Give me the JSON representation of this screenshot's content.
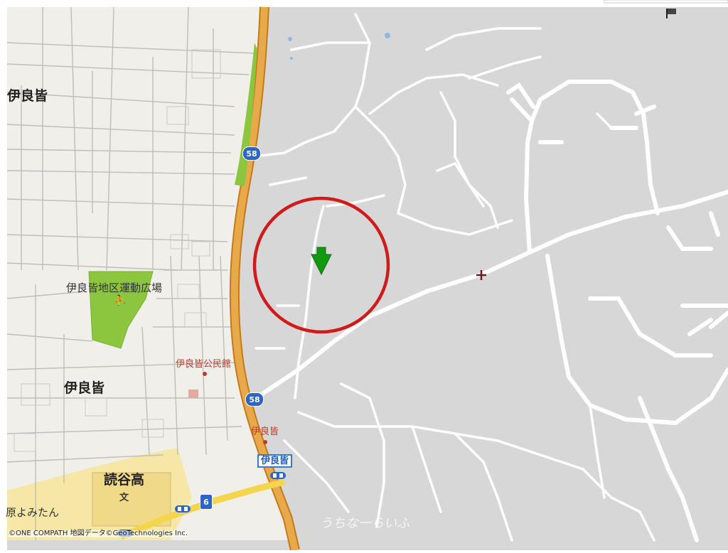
{
  "places": {
    "irabina_top": "伊良皆",
    "irabina_center": "伊良皆",
    "sports_ground": "伊良皆地区運動広場",
    "community_hall": "伊良皆公民館",
    "bus_stop": "伊良皆",
    "station_label": "伊良皆",
    "high_school": "読谷高",
    "school_symbol": "文",
    "park_symbol": "⛹",
    "yomitan": "原よみたん"
  },
  "routes": {
    "r58_top": "58",
    "r58_bottom": "58",
    "r6": "6"
  },
  "credit": "©ONE COMPATH 地図データ©GeoTechnologies Inc.",
  "watermark": "うちな一らいふ",
  "colors": {
    "base_land": "#d7d7d7",
    "town_land": "#f0efe9",
    "highway_fill": "#e8a94a",
    "highway_edge": "#c47a1a",
    "green_park": "#8cc63f",
    "school_yellow": "#f6e7a6",
    "circle_red": "#d11a1a",
    "marker_green": "#119a11"
  }
}
